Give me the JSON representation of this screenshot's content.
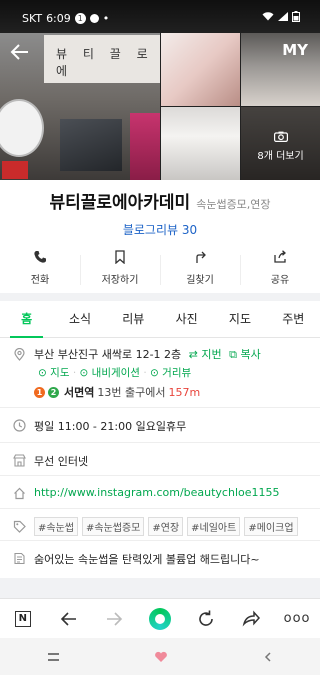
{
  "status_bar": {
    "carrier": "SKT",
    "time": "6:09",
    "notification_count": "1"
  },
  "header": {
    "my_label": "MY",
    "more_photos_label": "8개 더보기",
    "signboard_text": "뷰 티 끌 로 에"
  },
  "place": {
    "name": "뷰티끌로에아카데미",
    "category": "속눈썹증모,연장",
    "blog_review": "블로그리뷰 30"
  },
  "actions": [
    {
      "label": "전화",
      "icon": "phone-icon"
    },
    {
      "label": "저장하기",
      "icon": "bookmark-icon"
    },
    {
      "label": "길찾기",
      "icon": "directions-icon"
    },
    {
      "label": "공유",
      "icon": "share-icon"
    }
  ],
  "tabs": [
    "홈",
    "소식",
    "리뷰",
    "사진",
    "지도",
    "주변"
  ],
  "info": {
    "address": "부산 부산진구 새싹로 12-1 2층",
    "jibun_label": "⇄ 지번",
    "copy_label": "⧉ 복사",
    "map_label": "지도",
    "navigation_label": "내비게이션",
    "street_view_label": "거리뷰",
    "subway_line1": "1",
    "subway_line2": "2",
    "station": "서면역",
    "exit": "13번 출구에서",
    "distance": "157m",
    "hours": "평일 11:00 - 21:00 일요일휴무",
    "wifi": "무선 인터넷",
    "url": "http://www.instagram.com/beautychloe1155",
    "tags": [
      "#속눈썹",
      "#속눈썹증모",
      "#연장",
      "#네일아트",
      "#메이크업"
    ],
    "description": "숨어있는 속눈썹을 탄력있게 볼륨업 해드립니다~"
  },
  "toolbar": {
    "n_label": "N",
    "more_label": "ooo"
  },
  "colors": {
    "accent_green": "#03c75a",
    "link_blue": "#1d63c7",
    "distance_red": "#e8453c",
    "line1": "#f06a1f",
    "line2": "#2fa84b"
  }
}
